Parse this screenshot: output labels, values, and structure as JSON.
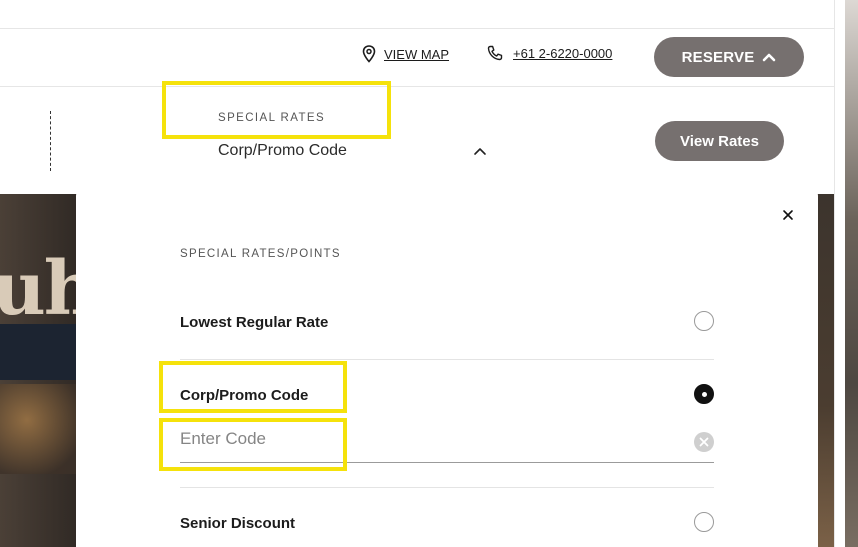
{
  "header": {
    "map_label": "VIEW MAP",
    "phone_label": "+61 2-6220-0000",
    "reserve_label": "RESERVE"
  },
  "booking_bar": {
    "special_rates_label": "SPECIAL RATES",
    "special_rates_value": "Corp/Promo Code",
    "view_rates_label": "View Rates"
  },
  "hero": {
    "letters": "uh"
  },
  "modal": {
    "title": "SPECIAL RATES/POINTS",
    "options": [
      {
        "label": "Lowest Regular Rate",
        "selected": false
      },
      {
        "label": "Corp/Promo Code",
        "selected": true
      },
      {
        "label": "Senior Discount",
        "selected": false
      }
    ],
    "code_input": {
      "placeholder": "Enter Code",
      "value": ""
    }
  },
  "colors": {
    "button_bg": "#76706f",
    "highlight": "#f5e20b",
    "radio_selected": "#111111"
  },
  "icons": [
    "map-pin-icon",
    "phone-icon",
    "chevron-up-icon",
    "close-icon",
    "clear-icon"
  ]
}
